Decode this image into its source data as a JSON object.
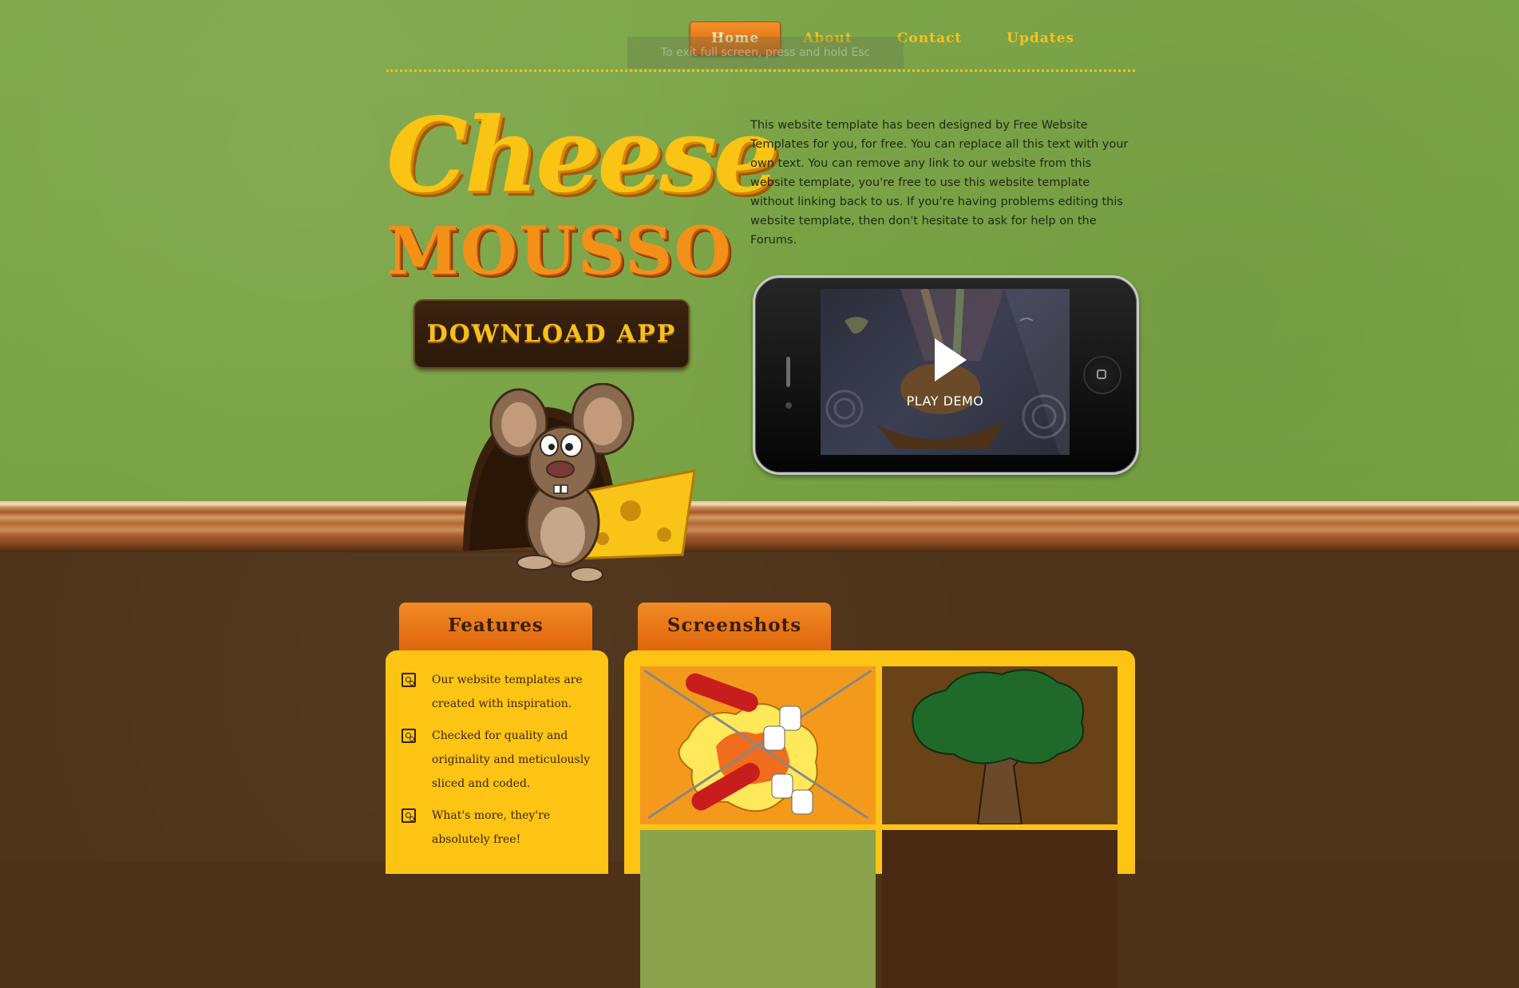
{
  "nav": {
    "items": [
      {
        "label": "Home",
        "active": true
      },
      {
        "label": "About",
        "active": false
      },
      {
        "label": "Contact",
        "active": false
      },
      {
        "label": "Updates",
        "active": false
      }
    ],
    "tooltip": "To exit full screen, press and hold Esc"
  },
  "logo": {
    "top": "Cheese",
    "bottom": "MOUSSO"
  },
  "download_button": "DOWNLOAD APP",
  "intro": "This website template has been designed by Free Website Templates for you, for free. You can replace all this text with your own text. You can remove any link to our website from this website template, you're free to use this website template without linking back to us. If you're having problems editing this website template, then don't hesitate to ask for help on the Forums.",
  "phone": {
    "play_label": "PLAY DEMO",
    "play_icon": "play-icon"
  },
  "tabs": {
    "features": "Features",
    "screenshots": "Screenshots"
  },
  "features": [
    "Our website templates are created with inspiration.",
    "Checked for quality and originality and meticulously sliced and coded.",
    "What's more, they're absolutely free!"
  ],
  "colors": {
    "grass": "#7ea649",
    "soil": "#4e3319",
    "accent_yellow": "#fdc413",
    "accent_orange": "#e0650c",
    "nav_text": "#f7c21b"
  }
}
